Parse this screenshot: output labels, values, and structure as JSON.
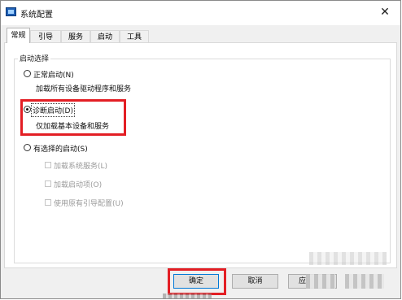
{
  "window": {
    "title": "系统配置"
  },
  "tabs": [
    {
      "label": "常规",
      "active": true
    },
    {
      "label": "引导",
      "active": false
    },
    {
      "label": "服务",
      "active": false
    },
    {
      "label": "启动",
      "active": false
    },
    {
      "label": "工具",
      "active": false
    }
  ],
  "startup": {
    "group_label": "启动选择",
    "normal": {
      "label": "正常启动(N)",
      "desc": "加载所有设备驱动程序和服务",
      "checked": false
    },
    "diagnostic": {
      "label": "诊断启动(D)",
      "desc": "仅加载基本设备和服务",
      "checked": true
    },
    "selective": {
      "label": "有选择的启动(S)",
      "checked": false,
      "options": [
        {
          "label": "加载系统服务(L)",
          "enabled": false
        },
        {
          "label": "加载启动项(O)",
          "enabled": false
        },
        {
          "label": "使用原有引导配置(U)",
          "enabled": false
        }
      ]
    }
  },
  "buttons": {
    "ok": "确定",
    "cancel": "取消",
    "apply": "应"
  },
  "colors": {
    "highlight": "#e31e24",
    "accent": "#0078d7"
  }
}
